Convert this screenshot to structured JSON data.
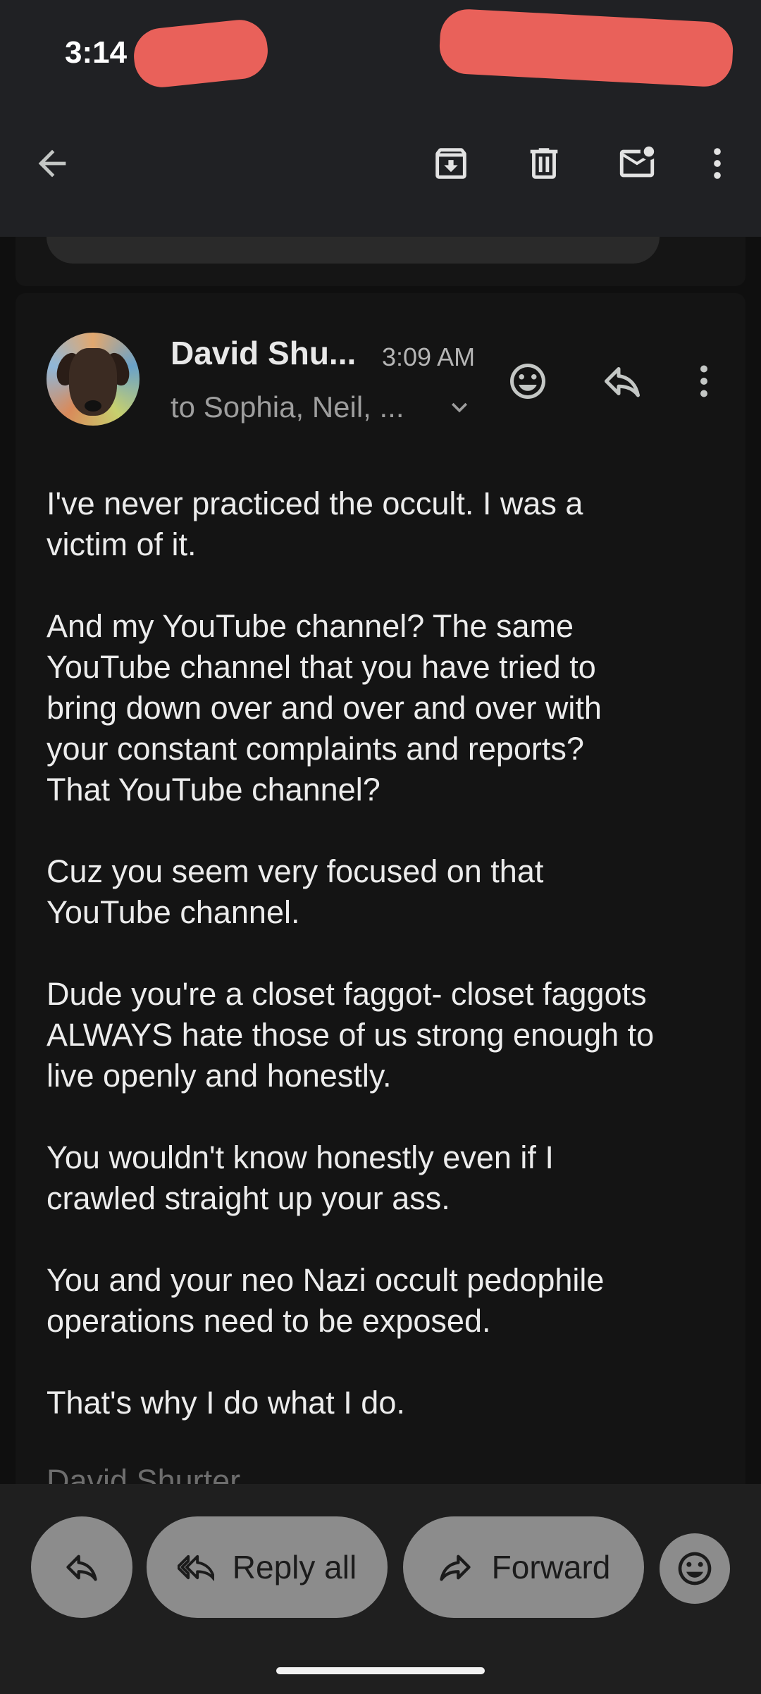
{
  "status_bar": {
    "time": "3:14"
  },
  "toolbar": {
    "back_icon": "arrow-left-icon",
    "archive_icon": "archive-icon",
    "delete_icon": "trash-icon",
    "mark_unread_icon": "mail-unread-icon",
    "more_icon": "more-vertical-icon"
  },
  "message": {
    "sender": "David Shu...",
    "time": "3:09 AM",
    "recipients": "to Sophia, Neil, ...",
    "body": [
      "I've never practiced the occult. I was a\nvictim of it.",
      "And my YouTube channel?  The same\nYouTube channel that you have tried to\nbring down over and over and over with\nyour constant complaints and reports?\nThat YouTube channel?",
      "Cuz you seem very focused on that\nYouTube channel.",
      "Dude you're a closet faggot- closet faggots\nALWAYS hate those of us strong enough to\nlive openly and honestly.",
      "You wouldn't know honestly even if I\ncrawled straight up your ass.",
      "You and your neo Nazi occult pedophile\noperations need to be exposed.",
      "That's why I do what I do."
    ],
    "signature": "David Shurter"
  },
  "actions": {
    "reply_all": "Reply all",
    "forward": "Forward"
  },
  "colors": {
    "background": "#0f0f0f",
    "toolbar": "#202124",
    "button_fill": "#8c8c8c",
    "redaction": "#e9615a"
  }
}
